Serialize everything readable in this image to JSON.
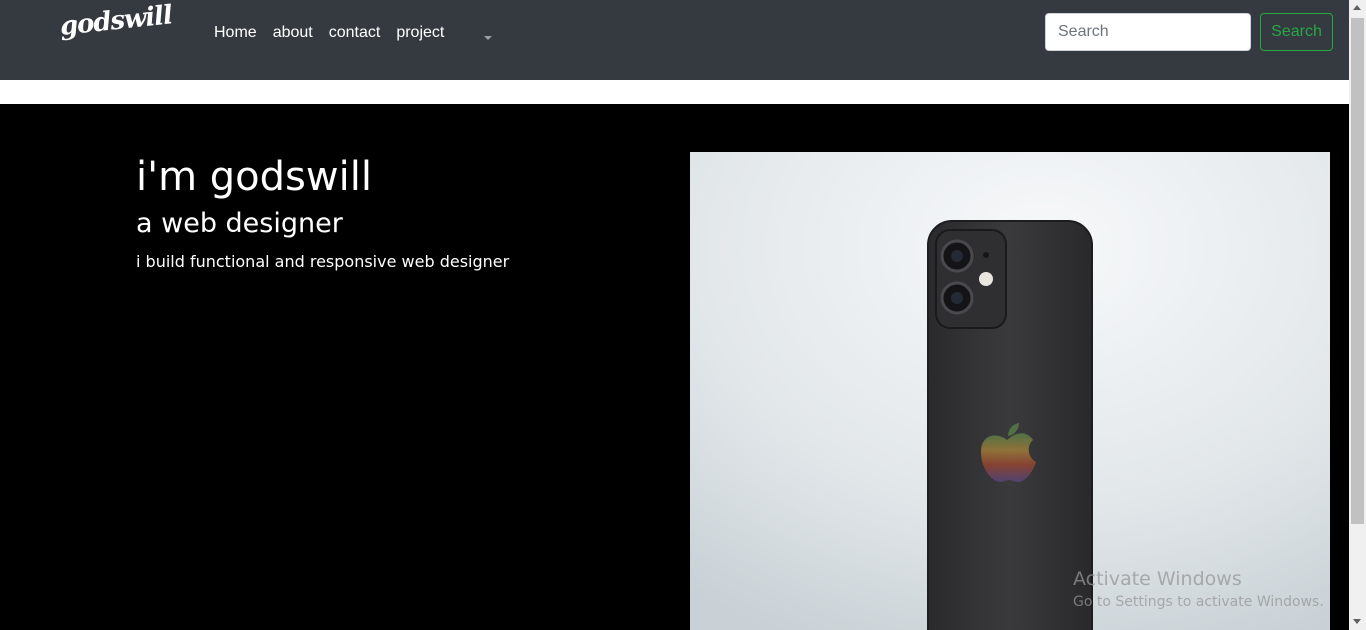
{
  "navbar": {
    "brand": "godswill",
    "links": [
      "Home",
      "about",
      "contact",
      "project"
    ],
    "dropdown_icon": "caret-down-icon",
    "search": {
      "placeholder": "Search",
      "value": "",
      "button_label": "Search"
    },
    "colors": {
      "background": "#343a40",
      "search_button": "#28a745"
    }
  },
  "hero": {
    "title": "i'm godswill",
    "subtitle": "a web designer",
    "text": "i build functional and responsive web designer",
    "image": "black smartphone on white background",
    "colors": {
      "background": "#000000",
      "text": "#ffffff"
    }
  },
  "watermark": {
    "line1": "Activate Windows",
    "line2": "Go to Settings to activate Windows."
  }
}
